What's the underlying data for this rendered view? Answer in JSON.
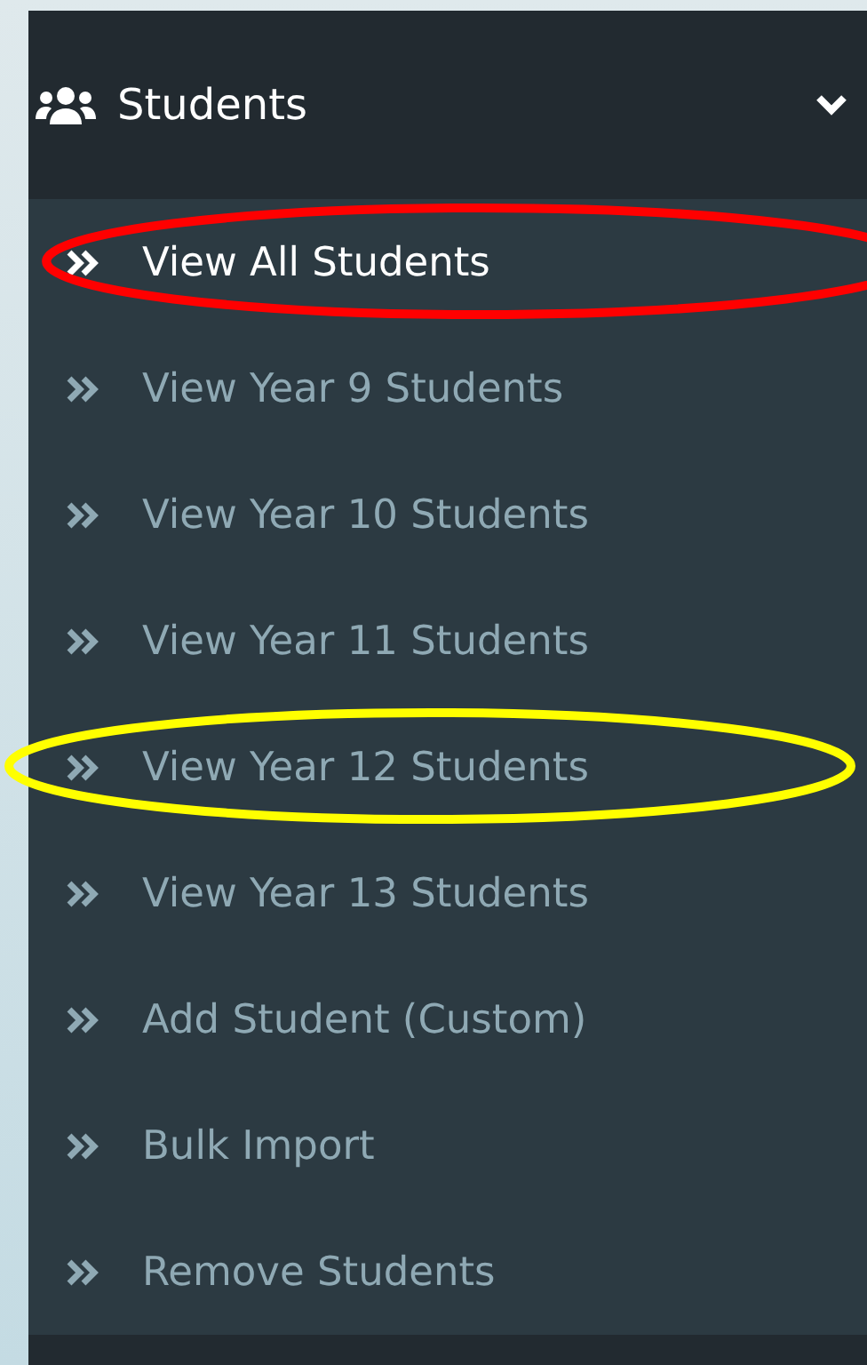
{
  "menu": {
    "title": "Students",
    "expanded": true
  },
  "items": [
    {
      "label": "View All Students",
      "selected": true,
      "color": "#ff0000"
    },
    {
      "label": "View Year 9 Students",
      "selected": false
    },
    {
      "label": "View Year 10 Students",
      "selected": false
    },
    {
      "label": "View Year 11 Students",
      "selected": false
    },
    {
      "label": "View Year 12 Students",
      "selected": false,
      "color": "#ffff00"
    },
    {
      "label": "View Year 13 Students",
      "selected": false
    },
    {
      "label": "Add Student (Custom)",
      "selected": false
    },
    {
      "label": "Bulk Import",
      "selected": false
    },
    {
      "label": "Remove Students",
      "selected": false
    }
  ]
}
